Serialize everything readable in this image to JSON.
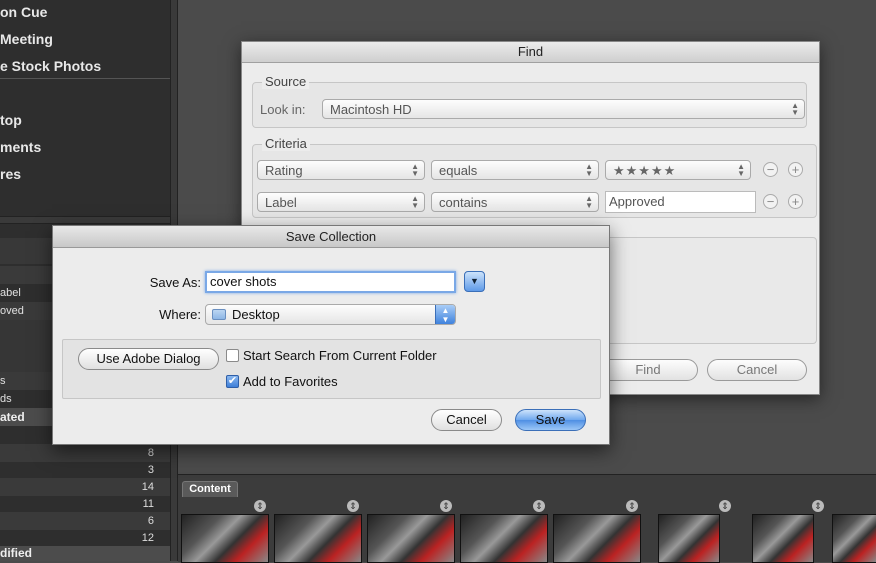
{
  "sidebar": {
    "favorites": [
      "on Cue",
      "Meeting",
      "e Stock Photos",
      "top",
      "ments",
      "res"
    ],
    "rows": [
      {
        "label": "abel",
        "num": ""
      },
      {
        "label": "oved",
        "num": ""
      },
      {
        "label": "s",
        "num": ""
      },
      {
        "label": "ds",
        "num": ""
      }
    ],
    "header_rated": "ated",
    "counts": [
      "8",
      "3",
      "14",
      "11",
      "6",
      "12"
    ],
    "header_modified": "dified"
  },
  "content_tab": "Content",
  "find": {
    "title": "Find",
    "source_label": "Source",
    "look_in_label": "Look in:",
    "look_in_value": "Macintosh HD",
    "criteria_label": "Criteria",
    "criteria": [
      {
        "field": "Rating",
        "op": "equals",
        "value": "★★★★★"
      },
      {
        "field": "Label",
        "op": "contains",
        "value": "Approved"
      }
    ],
    "minus": "−",
    "plus": "+",
    "find_button": "Find",
    "cancel_button": "Cancel"
  },
  "save": {
    "title": "Save Collection",
    "save_as_label": "Save As:",
    "save_as_value": "cover shots",
    "where_label": "Where:",
    "where_value": "Desktop",
    "use_adobe_dialog": "Use Adobe Dialog",
    "start_search_label": "Start Search From Current Folder",
    "start_search_checked": false,
    "add_favorites_label": "Add to Favorites",
    "add_favorites_checked": true,
    "cancel_button": "Cancel",
    "save_button": "Save"
  }
}
